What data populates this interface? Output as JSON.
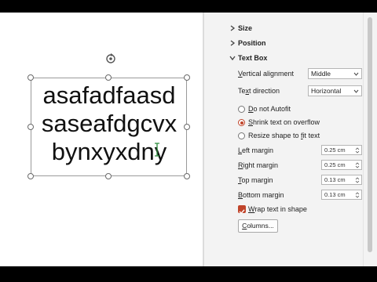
{
  "textbox": {
    "lines": [
      "asafadfaasd",
      "saseafdgcvx",
      "bynxyxdny"
    ]
  },
  "pane": {
    "sections": {
      "size": "Size",
      "position": "Position",
      "text_box": "Text Box"
    },
    "vertical_alignment": {
      "label_u": "V",
      "label_rest": "ertical alignment",
      "value": "Middle"
    },
    "text_direction": {
      "label_a": "Te",
      "label_u": "x",
      "label_rest": "t direction",
      "value": "Horizontal"
    },
    "autofit": {
      "do_not": {
        "u": "D",
        "rest": "o not Autofit"
      },
      "shrink": {
        "u": "S",
        "rest": "hrink text on overflow"
      },
      "resize": {
        "pre": "Resize shape to ",
        "u": "f",
        "rest": "it text"
      },
      "selected": "shrink"
    },
    "margins": {
      "left": {
        "label_u": "L",
        "label_rest": "eft margin",
        "value": "0.25 cm"
      },
      "right": {
        "label_u": "R",
        "label_rest": "ight margin",
        "value": "0.25 cm"
      },
      "top": {
        "label_u": "T",
        "label_rest": "op margin",
        "value": "0.13 cm"
      },
      "bottom": {
        "label_u": "B",
        "label_rest": "ottom margin",
        "value": "0.13 cm"
      }
    },
    "wrap": {
      "u": "W",
      "rest": "rap text in shape",
      "checked": true
    },
    "columns_button": {
      "u": "C",
      "rest": "olumns..."
    }
  },
  "colors": {
    "accent": "#c0442a",
    "pane_bg": "#f3f3f3"
  },
  "icons": {
    "rotate": "rotate-handle-icon",
    "chevron_right": "chevron-right-icon",
    "chevron_down": "chevron-down-icon",
    "cursor": "text-cursor-icon"
  }
}
